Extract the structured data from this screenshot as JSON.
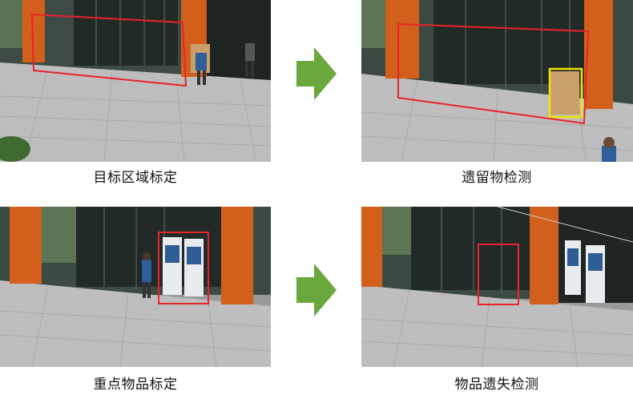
{
  "colors": {
    "arrow": "#6aa83e",
    "region_box": "#e8232a",
    "detect_box": "#f2e200",
    "pillar": "#d2601c"
  },
  "panels": [
    {
      "caption": "目标区域标定"
    },
    {
      "caption": "遗留物检测"
    },
    {
      "caption": "重点物品标定"
    },
    {
      "caption": "物品遗失检测"
    }
  ]
}
